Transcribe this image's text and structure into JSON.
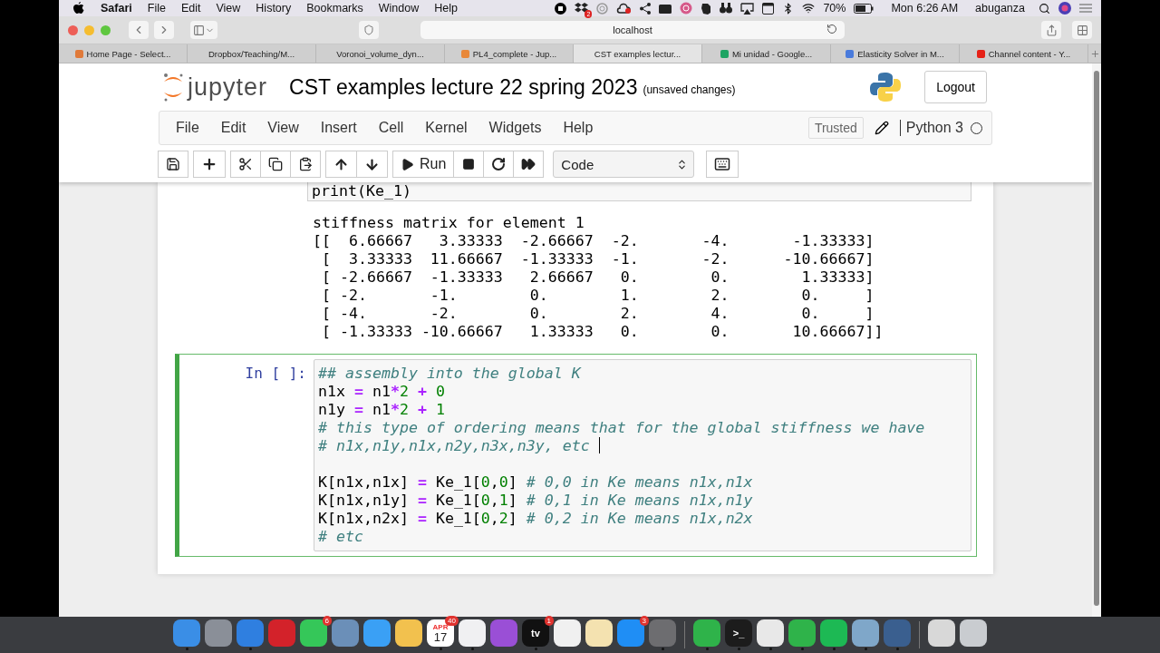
{
  "menubar": {
    "app": "Safari",
    "menus": [
      "File",
      "Edit",
      "View",
      "History",
      "Bookmarks",
      "Window",
      "Help"
    ],
    "badge": "2",
    "battery": "70%",
    "clock": "Mon 6:26 AM",
    "user": "abuganza"
  },
  "browser": {
    "address": "localhost",
    "tabs": [
      {
        "title": "Home Page - Select...",
        "selected": false,
        "color": "#e07a3a"
      },
      {
        "title": "Dropbox/Teaching/M...",
        "selected": false
      },
      {
        "title": "Voronoi_volume_dyn...",
        "selected": false
      },
      {
        "title": "PL4_complete - Jup...",
        "selected": false,
        "color": "#e8883a"
      },
      {
        "title": "CST examples lectur...",
        "selected": true
      },
      {
        "title": "Mi unidad - Google...",
        "selected": false,
        "color": "#1fa463"
      },
      {
        "title": "Elasticity Solver in M...",
        "selected": false,
        "color": "#4a7bdc"
      },
      {
        "title": "Channel content - Y...",
        "selected": false,
        "color": "#e62117"
      }
    ]
  },
  "jupyter": {
    "logo": "jupyter",
    "title": "CST examples lecture 22 spring 2023",
    "status": "(unsaved changes)",
    "logout": "Logout",
    "menus": [
      "File",
      "Edit",
      "View",
      "Insert",
      "Cell",
      "Kernel",
      "Widgets",
      "Help"
    ],
    "trusted": "Trusted",
    "kernel": "Python 3",
    "kernel_busy": false,
    "run": "Run",
    "cell_type": "Code"
  },
  "notebook": {
    "prev_input": "print(Ke_1)",
    "output": [
      "stiffness matrix for element 1",
      "[[  6.66667   3.33333  -2.66667  -2.       -4.       -1.33333]",
      " [  3.33333  11.66667  -1.33333  -1.       -2.      -10.66667]",
      " [ -2.66667  -1.33333   2.66667   0.        0.        1.33333]",
      " [ -2.       -1.        0.        1.        2.        0.     ]",
      " [ -4.       -2.        0.        2.        4.        0.     ]",
      " [ -1.33333 -10.66667   1.33333   0.        0.       10.66667]]"
    ],
    "cell": {
      "prompt": "In [ ]:",
      "selected": true,
      "lines": [
        {
          "cursor": false,
          "tokens": [
            {
              "kind": "comment",
              "text": "## assembly into the global K"
            }
          ]
        },
        {
          "cursor": false,
          "tokens": [
            {
              "kind": "plain",
              "text": "n1x "
            },
            {
              "kind": "op",
              "text": "="
            },
            {
              "kind": "plain",
              "text": " n1"
            },
            {
              "kind": "op",
              "text": "*"
            },
            {
              "kind": "num",
              "text": "2"
            },
            {
              "kind": "op",
              "text": " + "
            },
            {
              "kind": "num",
              "text": "0"
            }
          ]
        },
        {
          "cursor": false,
          "tokens": [
            {
              "kind": "plain",
              "text": "n1y "
            },
            {
              "kind": "op",
              "text": "="
            },
            {
              "kind": "plain",
              "text": " n1"
            },
            {
              "kind": "op",
              "text": "*"
            },
            {
              "kind": "num",
              "text": "2"
            },
            {
              "kind": "op",
              "text": " + "
            },
            {
              "kind": "num",
              "text": "1"
            }
          ]
        },
        {
          "cursor": false,
          "tokens": [
            {
              "kind": "comment",
              "text": "# this type of ordering means that for the global stiffness we have"
            }
          ]
        },
        {
          "cursor": true,
          "tokens": [
            {
              "kind": "comment",
              "text": "# n1x,n1y,n1x,n2y,n3x,n3y, etc "
            }
          ]
        },
        {
          "cursor": false
        },
        {
          "cursor": false,
          "tokens": [
            {
              "kind": "plain",
              "text": "K[n1x,n1x] "
            },
            {
              "kind": "op",
              "text": "="
            },
            {
              "kind": "plain",
              "text": " Ke_1["
            },
            {
              "kind": "num",
              "text": "0"
            },
            {
              "kind": "plain",
              "text": ","
            },
            {
              "kind": "num",
              "text": "0"
            },
            {
              "kind": "plain",
              "text": "] "
            },
            {
              "kind": "comment",
              "text": "# 0,0 in Ke means n1x,n1x"
            }
          ]
        },
        {
          "cursor": false,
          "tokens": [
            {
              "kind": "plain",
              "text": "K[n1x,n1y] "
            },
            {
              "kind": "op",
              "text": "="
            },
            {
              "kind": "plain",
              "text": " Ke_1["
            },
            {
              "kind": "num",
              "text": "0"
            },
            {
              "kind": "plain",
              "text": ","
            },
            {
              "kind": "num",
              "text": "1"
            },
            {
              "kind": "plain",
              "text": "] "
            },
            {
              "kind": "comment",
              "text": "# 0,1 in Ke means n1x,n1y"
            }
          ]
        },
        {
          "cursor": false,
          "tokens": [
            {
              "kind": "plain",
              "text": "K[n1x,n2x] "
            },
            {
              "kind": "op",
              "text": "="
            },
            {
              "kind": "plain",
              "text": " Ke_1["
            },
            {
              "kind": "num",
              "text": "0"
            },
            {
              "kind": "plain",
              "text": ","
            },
            {
              "kind": "num",
              "text": "2"
            },
            {
              "kind": "plain",
              "text": "] "
            },
            {
              "kind": "comment",
              "text": "# 0,2 in Ke means n1x,n2x"
            }
          ]
        },
        {
          "cursor": false,
          "tokens": [
            {
              "kind": "comment",
              "text": "# etc"
            }
          ]
        }
      ]
    }
  },
  "dock": {
    "groups": [
      [
        {
          "kind": "app",
          "color": "#3a8ee6",
          "running": true
        },
        {
          "kind": "app",
          "color": "#8a8f98",
          "running": false
        },
        {
          "kind": "app",
          "color": "#2f7fe0",
          "running": true
        },
        {
          "kind": "app",
          "color": "#d3222a",
          "running": false
        },
        {
          "kind": "app",
          "color": "#35c759",
          "running": false,
          "badge": "6"
        },
        {
          "kind": "app",
          "color": "#6b8fb8",
          "running": false
        },
        {
          "kind": "app",
          "color": "#3aa0f5",
          "running": false
        },
        {
          "kind": "app",
          "color": "#f2c14e",
          "running": false
        },
        {
          "kind": "calendar",
          "color": "#ffffff",
          "running": true,
          "month": "APR",
          "day": "17",
          "badge": "40"
        },
        {
          "kind": "app",
          "color": "#f0f0f2",
          "running": true
        },
        {
          "kind": "app",
          "color": "#9a4fd6",
          "running": false
        },
        {
          "kind": "app",
          "color": "#111111",
          "running": true,
          "label": "tv",
          "badge": "1"
        },
        {
          "kind": "app",
          "color": "#f0f0f0",
          "running": false
        },
        {
          "kind": "app",
          "color": "#f4e2b0",
          "running": false
        },
        {
          "kind": "app",
          "color": "#1f8ef5",
          "running": false,
          "badge": "3"
        },
        {
          "kind": "app",
          "color": "#6d6d70",
          "running": true
        }
      ],
      [
        {
          "kind": "app",
          "color": "#2fb34a",
          "running": true
        },
        {
          "kind": "app",
          "color": "#1c1c1c",
          "running": true,
          "label": ">_"
        },
        {
          "kind": "app",
          "color": "#e8e8e8",
          "running": true
        },
        {
          "kind": "app",
          "color": "#2fb34a",
          "running": true
        },
        {
          "kind": "app",
          "color": "#1db954",
          "running": true
        },
        {
          "kind": "app",
          "color": "#7fa7c9",
          "running": true
        },
        {
          "kind": "app",
          "color": "#3a5f8f",
          "running": true
        }
      ],
      [
        {
          "kind": "app",
          "color": "#d8d8d8",
          "running": false
        },
        {
          "kind": "app",
          "color": "#c9ccd0",
          "running": false
        }
      ]
    ]
  }
}
